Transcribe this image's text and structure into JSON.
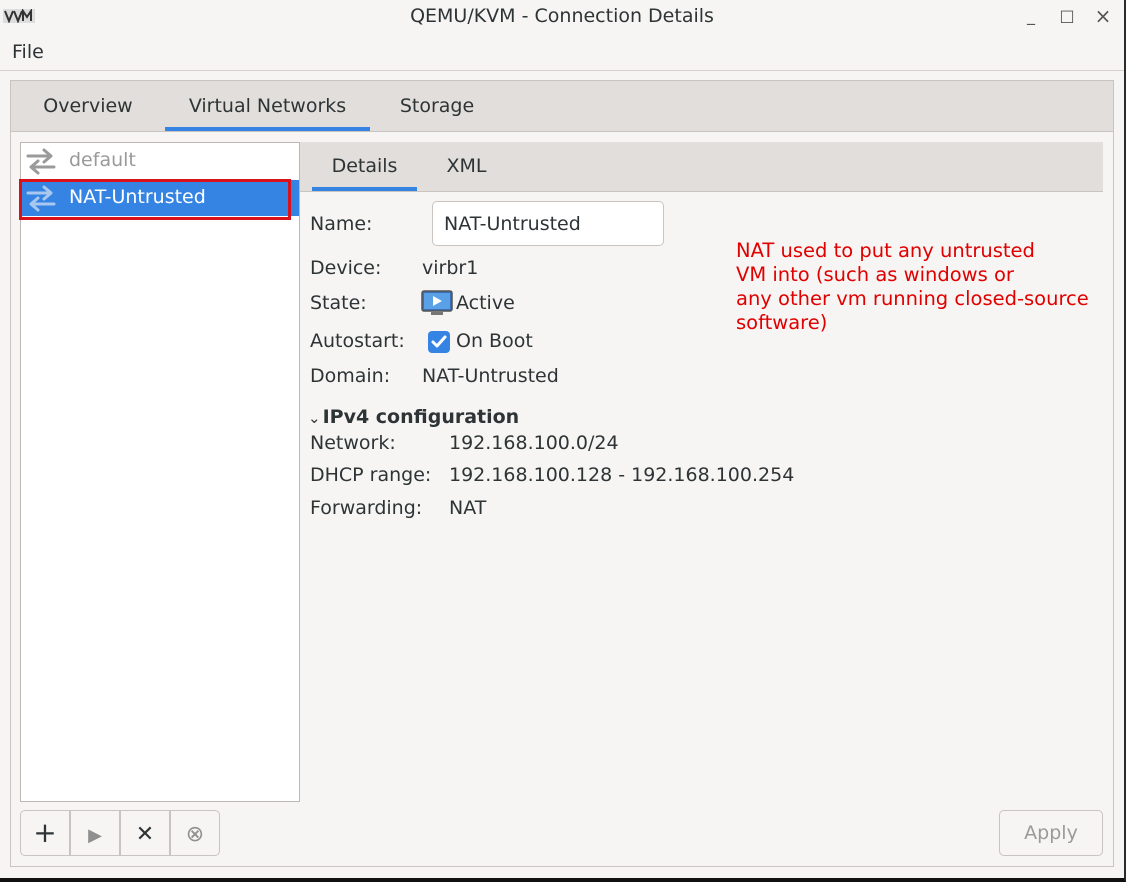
{
  "window": {
    "title": "QEMU/KVM - Connection Details",
    "controls": {
      "minimize": "_",
      "maximize": "□",
      "close": "×"
    }
  },
  "menubar": {
    "file": "File"
  },
  "outer_tabs": [
    {
      "label": "Overview",
      "active": false
    },
    {
      "label": "Virtual Networks",
      "active": true
    },
    {
      "label": "Storage",
      "active": false
    }
  ],
  "networks": [
    {
      "label": "default",
      "selected": false,
      "active": false
    },
    {
      "label": "NAT-Untrusted",
      "selected": true,
      "active": true
    }
  ],
  "inner_tabs": [
    {
      "label": "Details",
      "active": true
    },
    {
      "label": "XML",
      "active": false
    }
  ],
  "details": {
    "name_label": "Name:",
    "name_value": "NAT-Untrusted",
    "device_label": "Device:",
    "device_value": "virbr1",
    "state_label": "State:",
    "state_value": "Active",
    "autostart_label": "Autostart:",
    "autostart_value": "On Boot",
    "autostart_checked": true,
    "domain_label": "Domain:",
    "domain_value": "NAT-Untrusted"
  },
  "ipv4": {
    "heading": "IPv4 configuration",
    "network_label": "Network:",
    "network_value": "192.168.100.0/24",
    "dhcp_label": "DHCP range:",
    "dhcp_value": "192.168.100.128 - 192.168.100.254",
    "forwarding_label": "Forwarding:",
    "forwarding_value": "NAT"
  },
  "annotation": {
    "text": "NAT used to put any untrusted\nVM into (such as windows or\nany other vm running closed-source\nsoftware)",
    "color": "#e00000"
  },
  "toolbar": {
    "add": "+",
    "start": "▶",
    "delete": "✕",
    "stop": "⊗",
    "apply": "Apply"
  },
  "colors": {
    "accent": "#3584e4",
    "highlight": "#d8111b"
  }
}
